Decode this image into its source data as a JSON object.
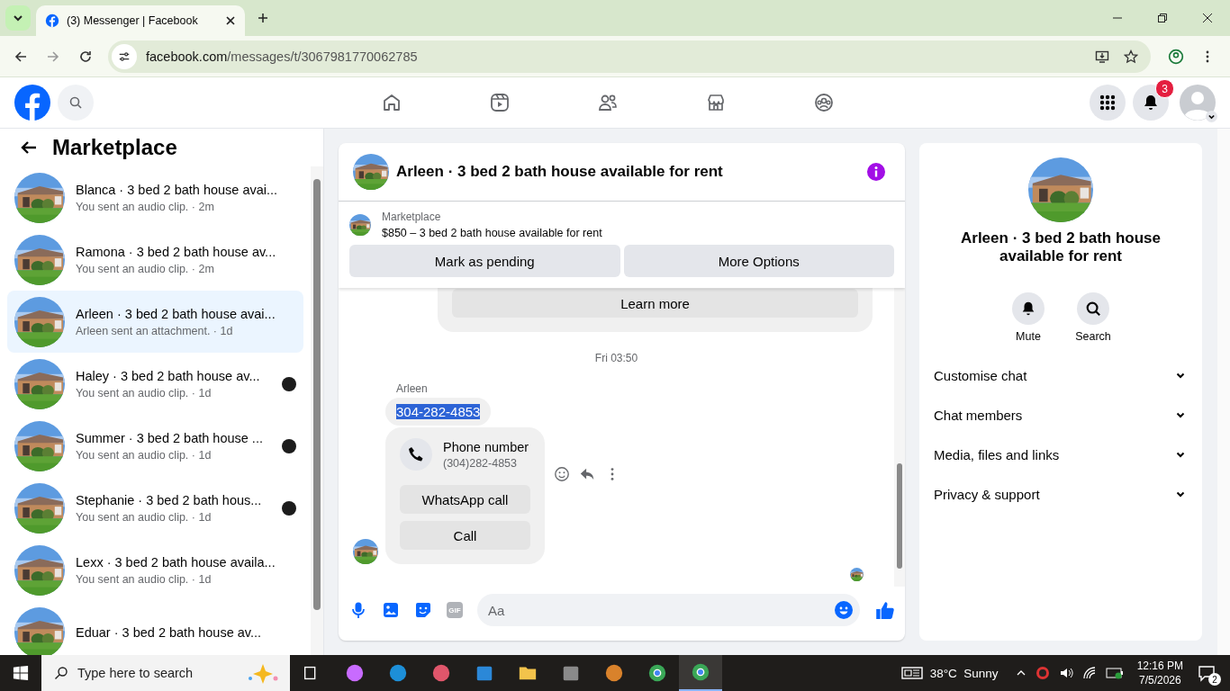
{
  "browser": {
    "tab_title": "(3) Messenger | Facebook",
    "url_host": "facebook.com",
    "url_path": "/messages/t/3067981770062785"
  },
  "notifications": {
    "badge": "3"
  },
  "sidebar": {
    "title": "Marketplace",
    "conversations": [
      {
        "title": "Blanca · 3 bed 2 bath house avai...",
        "preview": "You sent an audio clip. · 2m",
        "selected": false,
        "seen": false
      },
      {
        "title": "Ramona · 3 bed 2 bath house av...",
        "preview": "You sent an audio clip. · 2m",
        "selected": false,
        "seen": false
      },
      {
        "title": "Arleen · 3 bed 2 bath house avai...",
        "preview": "Arleen sent an attachment. · 1d",
        "selected": true,
        "seen": false
      },
      {
        "title": "Haley · 3 bed 2 bath house av...",
        "preview": "You sent an audio clip. · 1d",
        "selected": false,
        "seen": true
      },
      {
        "title": "Summer · 3 bed 2 bath house ...",
        "preview": "You sent an audio clip. · 1d",
        "selected": false,
        "seen": true
      },
      {
        "title": "Stephanie · 3 bed 2 bath hous...",
        "preview": "You sent an audio clip. · 1d",
        "selected": false,
        "seen": true
      },
      {
        "title": "Lexx · 3 bed 2 bath house availa...",
        "preview": "You sent an audio clip. · 1d",
        "selected": false,
        "seen": false
      },
      {
        "title": "Eduar · 3 bed 2 bath house av...",
        "selected": false,
        "seen": false
      }
    ]
  },
  "chat": {
    "title": "Arleen · 3 bed 2 bath house available for rent",
    "listing": {
      "label": "Marketplace",
      "summary": "$850 – 3 bed 2 bath house available for rent",
      "buttons": [
        "Mark as pending",
        "More Options"
      ]
    },
    "card_button": "Learn more",
    "timestamp": "Fri 03:50",
    "sender": "Arleen",
    "message": {
      "text": "304-282-4853",
      "highlighted": true
    },
    "phone_card": {
      "title": "Phone number",
      "number": "(304)282-4853",
      "buttons": [
        "WhatsApp call",
        "Call"
      ]
    },
    "composer": {
      "gif_label": "GIF",
      "placeholder": "Aa"
    }
  },
  "details": {
    "title": "Arleen · 3 bed 2 bath house available for rent",
    "actions": [
      {
        "kind": "mute",
        "label": "Mute"
      },
      {
        "kind": "search",
        "label": "Search"
      }
    ],
    "sections": [
      {
        "label": "Customise chat",
        "expanded": false
      },
      {
        "label": "Chat members",
        "expanded": false
      },
      {
        "label": "Media, files and links",
        "expanded": false
      },
      {
        "label": "Privacy & support",
        "expanded": false
      }
    ]
  },
  "taskbar": {
    "search_placeholder": "Type here to search",
    "apps": [
      {
        "kind": "taskview",
        "active": false
      },
      {
        "kind": "copilot",
        "active": false
      },
      {
        "kind": "edge",
        "active": false
      },
      {
        "kind": "snip",
        "active": false
      },
      {
        "kind": "store",
        "active": false
      },
      {
        "kind": "folder",
        "active": false
      },
      {
        "kind": "video",
        "active": false
      },
      {
        "kind": "gauge",
        "active": false
      },
      {
        "kind": "chrome",
        "active": false
      },
      {
        "kind": "chrome",
        "active": true
      }
    ],
    "weather": "38°C  Sunny",
    "time": "12:16 PM",
    "date": "7/5/2026",
    "notification_count": "2"
  }
}
